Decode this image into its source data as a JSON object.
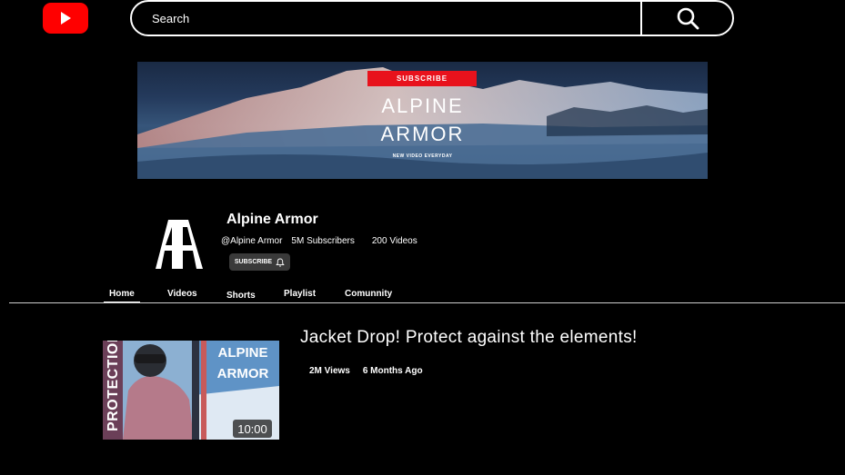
{
  "header": {
    "logo": "youtube-logo",
    "search_placeholder": "Search",
    "search_icon": "search-icon"
  },
  "banner": {
    "subscribe_label": "SUBSCRIBE",
    "title_line1": "ALPINE",
    "title_line2": "ARMOR",
    "tagline": "NEW VIDEO EVERYDAY"
  },
  "channel": {
    "logo_text": "AA",
    "name": "Alpine Armor",
    "handle": "@Alpine Armor",
    "subscribers": "5M Subscribers",
    "videos": "200 Videos",
    "subscribe_label": "SUBSCRIBE"
  },
  "tabs": [
    {
      "label": "Home"
    },
    {
      "label": "Videos"
    },
    {
      "label": "Shorts"
    },
    {
      "label": "Playlist"
    },
    {
      "label": "Comunnity"
    }
  ],
  "video": {
    "title": "Jacket Drop! Protect against the elements!",
    "views": "2M Views",
    "age": "6 Months Ago",
    "duration": "10:00",
    "thumb_side_text": "PROTECTION",
    "thumb_title1": "ALPINE",
    "thumb_title2": "ARMOR"
  },
  "colors": {
    "background": "#000000",
    "youtube_red": "#ff0000",
    "banner_subscribe": "#e8121c",
    "subscribe_button": "#3a3a3a"
  }
}
